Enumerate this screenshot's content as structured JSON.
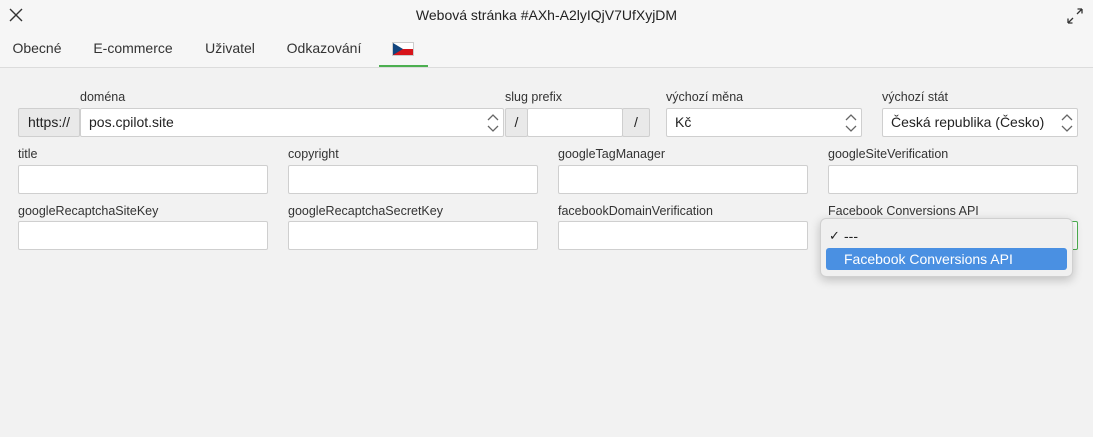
{
  "window": {
    "title": "Webová stránka #AXh-A2lyIQjV7UfXyjDM"
  },
  "tabs": [
    {
      "label": "Obecné"
    },
    {
      "label": "E-commerce"
    },
    {
      "label": "Uživatel"
    },
    {
      "label": "Odkazování"
    }
  ],
  "domain_row": {
    "domain_label": "doména",
    "protocol": "https://",
    "domain_value": "pos.cpilot.site",
    "slug_label": "slug prefix",
    "slug_prefix_addon": "/",
    "slug_suffix_addon": "/",
    "slug_value": "",
    "currency_label": "výchozí měna",
    "currency_value": "Kč",
    "country_label": "výchozí stát",
    "country_value": "Česká republika (Česko)"
  },
  "fields": {
    "title": {
      "label": "title",
      "value": ""
    },
    "copyright": {
      "label": "copyright",
      "value": ""
    },
    "google_tag_manager": {
      "label": "googleTagManager",
      "value": ""
    },
    "google_site_verification": {
      "label": "googleSiteVerification",
      "value": ""
    },
    "recaptcha_site_key": {
      "label": "googleRecaptchaSiteKey",
      "value": ""
    },
    "recaptcha_secret_key": {
      "label": "googleRecaptchaSecretKey",
      "value": ""
    },
    "facebook_domain_verification": {
      "label": "facebookDomainVerification",
      "value": ""
    },
    "facebook_conversions": {
      "label": "Facebook Conversions API"
    }
  },
  "dropdown": {
    "options": [
      {
        "label": "---",
        "checked": true
      },
      {
        "label": "Facebook Conversions API",
        "highlighted": true
      }
    ]
  },
  "colors": {
    "accent": "#4caf50",
    "highlight": "#4a90e2"
  }
}
